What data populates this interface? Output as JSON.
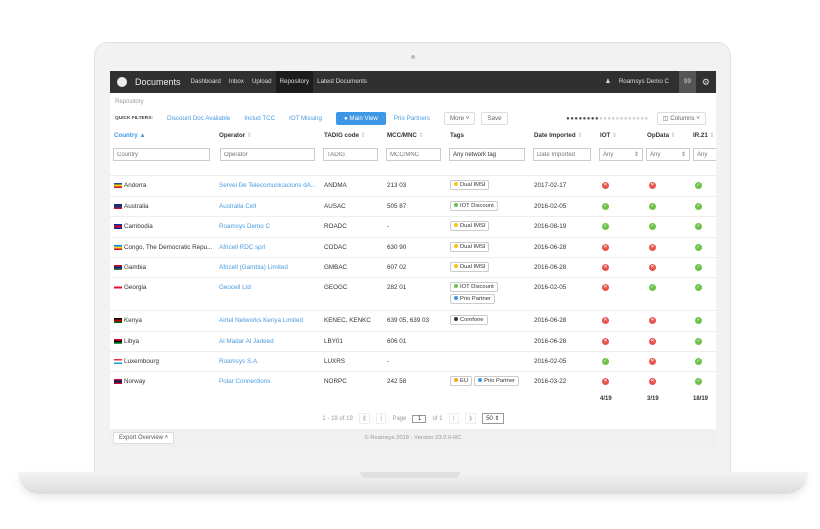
{
  "nav": {
    "brand": "Documents",
    "links": [
      "Dashboard",
      "Inbox",
      "Upload",
      "Repository",
      "Latest Documents"
    ],
    "active": "Repository",
    "user": "Roamsys Demo C",
    "count": "99"
  },
  "breadcrumb": "Repository",
  "quick_filters": {
    "label": "QUICK FILTERS:",
    "items": [
      "Discount Doc Available",
      "Includ TCC",
      "IOT Missing"
    ],
    "active": "Main View",
    "after": "Prio Partners",
    "more": "More",
    "save": "Save",
    "columns": "Columns"
  },
  "columns": [
    "Country",
    "Operator",
    "TADIG code",
    "MCC/MNC",
    "Tags",
    "Date Imported",
    "IOT",
    "OpData",
    "IR.21"
  ],
  "filters": {
    "country": "Country",
    "operator": "Operator",
    "tadig": "TADIG",
    "mcc": "MCC/MNC",
    "tags": "Any network tag",
    "date": "Date Imported",
    "any": "Any"
  },
  "rows": [
    {
      "country": "Andorra",
      "flag": [
        "#1d4fa0",
        "#f5d000",
        "#d0103a"
      ],
      "operator": "Servei De Telecomunicacions dA...",
      "tadig": "ANDMA",
      "mcc": "213 03",
      "tags": [
        {
          "label": "Dual IMSI",
          "color": "#f5c518"
        }
      ],
      "date": "2017-02-17",
      "iot": false,
      "opdata": false,
      "ir21": true
    },
    {
      "country": "Australia",
      "flag": [
        "#1a2f7a",
        "#1a2f7a",
        "#c8102e"
      ],
      "operator": "Australia Cell",
      "tadig": "AUSAC",
      "mcc": "505 87",
      "tags": [
        {
          "label": "IOT Discount",
          "color": "#6cc24a"
        }
      ],
      "date": "2016-02-05",
      "iot": true,
      "opdata": true,
      "ir21": true
    },
    {
      "country": "Cambodia",
      "flag": [
        "#032ea1",
        "#e00025",
        "#032ea1"
      ],
      "operator": "Roamsys Demo C",
      "tadig": "ROADC",
      "mcc": "-",
      "tags": [
        {
          "label": "Dual IMSI",
          "color": "#f5c518"
        }
      ],
      "date": "2016-08-19",
      "iot": true,
      "opdata": true,
      "ir21": true
    },
    {
      "country": "Congo, The Democratic Repu...",
      "flag": [
        "#007fff",
        "#f7d618",
        "#ce1021"
      ],
      "operator": "Africell RDC sprl",
      "tadig": "CODAC",
      "mcc": "630 90",
      "tags": [
        {
          "label": "Dual IMSI",
          "color": "#f5c518"
        }
      ],
      "date": "2016-06-28",
      "iot": false,
      "opdata": false,
      "ir21": true
    },
    {
      "country": "Gambia",
      "flag": [
        "#ce1126",
        "#0c1c8c",
        "#3a7728"
      ],
      "operator": "Africell (Gambia) Limited",
      "tadig": "GMBAC",
      "mcc": "607 02",
      "tags": [
        {
          "label": "Dual IMSI",
          "color": "#f5c518"
        }
      ],
      "date": "2016-06-28",
      "iot": false,
      "opdata": false,
      "ir21": true
    },
    {
      "country": "Georgia",
      "flag": [
        "#ffffff",
        "#e8112d",
        "#ffffff"
      ],
      "operator": "Geocell Ltd",
      "tadig": "GEOGC",
      "mcc": "282 01",
      "tags": [
        {
          "label": "IOT Discount",
          "color": "#6cc24a"
        },
        {
          "label": "Prio Partner",
          "color": "#3d97e4"
        }
      ],
      "date": "2016-02-05",
      "iot": false,
      "opdata": true,
      "ir21": true
    },
    {
      "country": "Kenya",
      "flag": [
        "#000000",
        "#bb0000",
        "#006600"
      ],
      "operator": "Airtel Networks Kenya Limited",
      "tadig": "KENEC, KENKC",
      "mcc": "639 05, 639 03",
      "tags": [
        {
          "label": "Comfone",
          "color": "#333333"
        }
      ],
      "date": "2016-06-28",
      "iot": false,
      "opdata": false,
      "ir21": true
    },
    {
      "country": "Libya",
      "flag": [
        "#e70013",
        "#000000",
        "#239e46"
      ],
      "operator": "Al Madar Al Jadeed",
      "tadig": "LBY01",
      "mcc": "606 01",
      "tags": [],
      "date": "2016-06-28",
      "iot": false,
      "opdata": false,
      "ir21": true
    },
    {
      "country": "Luxembourg",
      "flag": [
        "#ed2939",
        "#ffffff",
        "#00a1de"
      ],
      "operator": "Roamsys S.A.",
      "tadig": "LUXRS",
      "mcc": "-",
      "tags": [],
      "date": "2016-02-05",
      "iot": true,
      "opdata": false,
      "ir21": true
    },
    {
      "country": "Norway",
      "flag": [
        "#ba0c2f",
        "#00205b",
        "#ba0c2f"
      ],
      "operator": "Polar Connections",
      "tadig": "NORPC",
      "mcc": "242 58",
      "tags": [
        {
          "label": "EU",
          "color": "#f5a623"
        },
        {
          "label": "Prio Partner",
          "color": "#3d97e4"
        }
      ],
      "date": "2016-03-22",
      "iot": false,
      "opdata": false,
      "ir21": true
    }
  ],
  "totals": {
    "iot": "4/19",
    "opdata": "3/19",
    "ir21": "18/19"
  },
  "pagination": {
    "range": "1 - 19 of 19",
    "page_label": "Page",
    "page": "1",
    "of": "of 1",
    "per_page": "50"
  },
  "footer": {
    "export": "Export Overview",
    "copyright": "© Roamsys 2018 - Version 23.0.0-RC"
  }
}
